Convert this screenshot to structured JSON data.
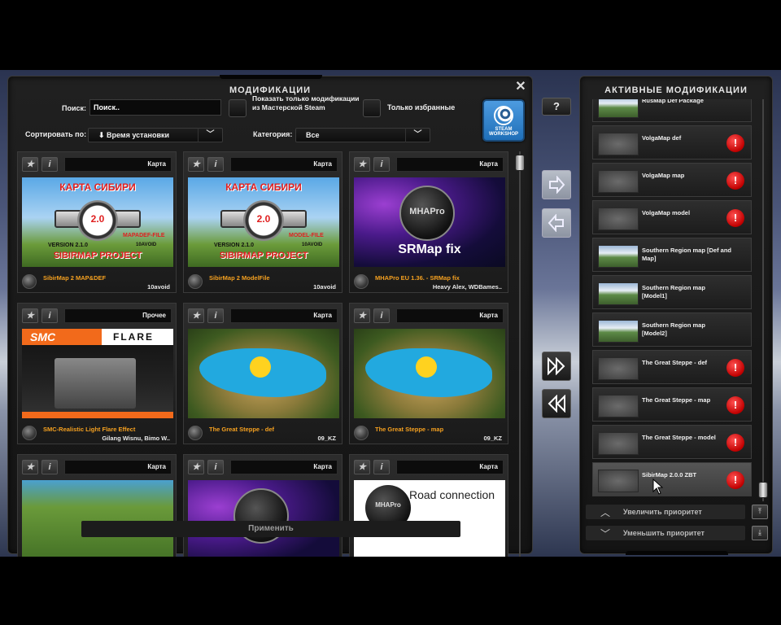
{
  "mods_panel": {
    "title": "МОДИФИКАЦИИ",
    "close_label": "✕",
    "search_label": "Поиск:",
    "search_value": "Поиск..",
    "workshop_only_label": "Показать только модификации из Мастерской Steam",
    "favorites_only_label": "Только избранные",
    "sort_label": "Сортировать по:",
    "sort_value": "⬇ Время установки",
    "category_label": "Категория:",
    "category_value": "Все",
    "workshop_button": "STEAM WORKSHOP",
    "apply_button": "Применить"
  },
  "mod_cards": [
    {
      "category": "Карта",
      "name": "SibirMap 2 MAP&DEF",
      "author": "10avoid",
      "thumb": "sibirmap-mapdef"
    },
    {
      "category": "Карта",
      "name": "SibirMap 2 ModelFile",
      "author": "10avoid",
      "thumb": "sibirmap-model"
    },
    {
      "category": "Карта",
      "name": "MHAPro EU 1.36. - SRMap fix",
      "author": "Heavy Alex, WDBames..",
      "thumb": "srmap-fix"
    },
    {
      "category": "Прочее",
      "name": "SMC-Realistic Light Flare Effect",
      "author": "Gilang Wisnu, Bimo W..",
      "thumb": "smc-flare"
    },
    {
      "category": "Карта",
      "name": "The Great Steppe - def",
      "author": "09_KZ",
      "thumb": "kz-map"
    },
    {
      "category": "Карта",
      "name": "The Great Steppe - map",
      "author": "09_KZ",
      "thumb": "kz-map"
    },
    {
      "category": "Карта",
      "name": "",
      "author": "",
      "thumb": "green-map"
    },
    {
      "category": "Карта",
      "name": "",
      "author": "",
      "thumb": "purple-logo"
    },
    {
      "category": "Карта",
      "name": "",
      "author": "",
      "thumb": "road-connection"
    }
  ],
  "thumb_text": {
    "sibir_title": "КАРТА СИБИРИ",
    "sibir_version_num": "2.0",
    "sibir_mapdef": "MAPADEF-FILE",
    "sibir_model": "MODEL-FILE",
    "sibir_version": "VERSION 2.1.0",
    "sibir_author": "10AVOID",
    "sibir_project": "SIBIRMAP PROJECT",
    "mhapro": "MHAPro",
    "srmap_fix": "SRMap fix",
    "smc": "SMC",
    "flare": "FLARE",
    "road_connection": "Road connection"
  },
  "active_panel": {
    "title": "АКТИВНЫЕ МОДИФИКАЦИИ",
    "increase_priority": "Увеличить приоритет",
    "decrease_priority": "Уменьшить приоритет",
    "items": [
      {
        "name": "RusMap Def Package",
        "thumb": "photo",
        "warning": false
      },
      {
        "name": "VolgaMap def",
        "thumb": "gray",
        "warning": true
      },
      {
        "name": "VolgaMap map",
        "thumb": "gray",
        "warning": true
      },
      {
        "name": "VolgaMap model",
        "thumb": "gray",
        "warning": true
      },
      {
        "name": "Southern Region map [Def and Map]",
        "thumb": "photo",
        "warning": false
      },
      {
        "name": "Southern Region map [Model1]",
        "thumb": "photo",
        "warning": false
      },
      {
        "name": "Southern Region map [Model2]",
        "thumb": "photo",
        "warning": false
      },
      {
        "name": "The Great Steppe - def",
        "thumb": "gray",
        "warning": true
      },
      {
        "name": "The Great Steppe - map",
        "thumb": "gray",
        "warning": true
      },
      {
        "name": "The Great Steppe - model",
        "thumb": "gray",
        "warning": true
      },
      {
        "name": "SibirMap 2.0.0 ZBT",
        "thumb": "gray",
        "warning": true
      }
    ]
  },
  "help_label": "?",
  "colors": {
    "mod_name": "#f4a020",
    "warning": "#c00000"
  }
}
